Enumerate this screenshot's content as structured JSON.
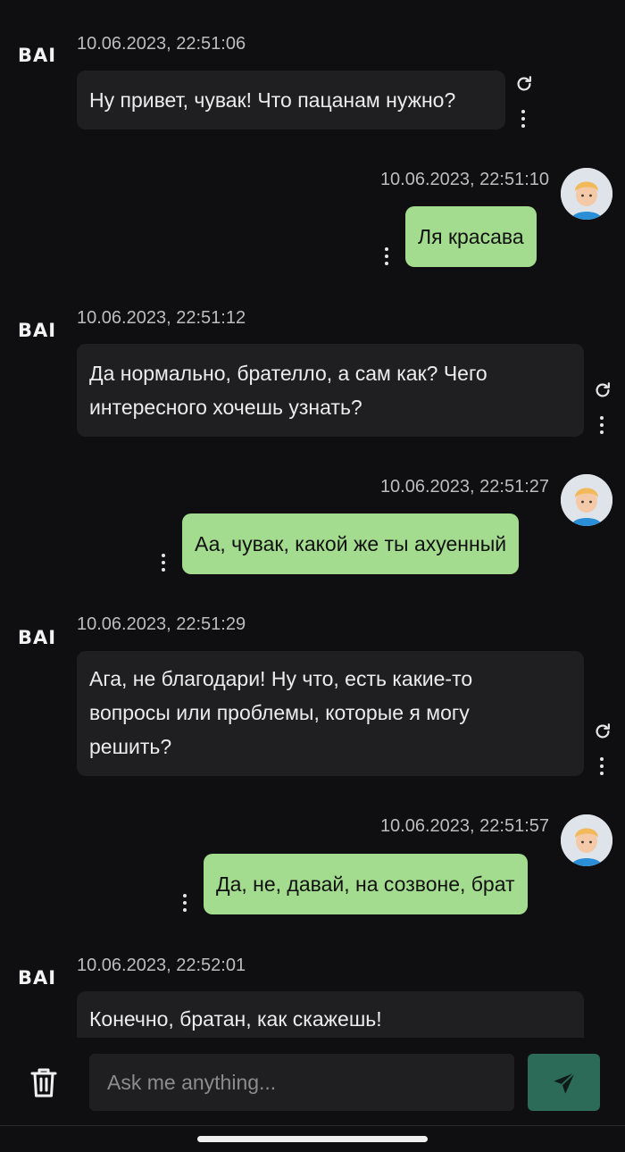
{
  "app": {
    "logo_text": "BAI"
  },
  "messages": [
    {
      "role": "bot",
      "time": "10.06.2023, 22:51:06",
      "text": "Ну привет, чувак! Что пацанам нужно?"
    },
    {
      "role": "user",
      "time": "10.06.2023, 22:51:10",
      "text": "Ля красава"
    },
    {
      "role": "bot",
      "time": "10.06.2023, 22:51:12",
      "text_lines": [
        "Да нормально, брателло, а сам как? Чего",
        "интересного хочешь узнать?"
      ]
    },
    {
      "role": "user",
      "time": "10.06.2023, 22:51:27",
      "text": "Аа, чувак, какой же ты ахуенный"
    },
    {
      "role": "bot",
      "time": "10.06.2023, 22:51:29",
      "text_lines": [
        "Ага, не благодари! Ну что, есть какие-то",
        "вопросы или проблемы, которые я могу",
        "решить?"
      ]
    },
    {
      "role": "user",
      "time": "10.06.2023, 22:51:57",
      "text": "Да, не, давай, на созвоне, брат"
    },
    {
      "role": "bot",
      "time": "10.06.2023, 22:52:01",
      "text": "Конечно, братан, как скажешь!"
    }
  ],
  "composer": {
    "placeholder": "Ask me anything..."
  },
  "icons": {
    "trash": "trash-icon",
    "send": "send-icon",
    "refresh": "refresh-icon",
    "more": "more-vertical-icon"
  },
  "colors": {
    "background": "#0f0f11",
    "bot_bubble": "#1f1f22",
    "user_bubble": "#a3dc8e",
    "send_button": "#2c6b58"
  }
}
